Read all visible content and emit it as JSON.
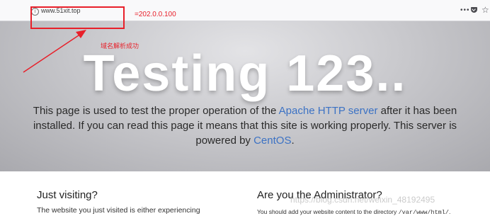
{
  "browser": {
    "url": "www.51xit.top",
    "info_icon": "info-icon",
    "more_icon": "more-icon",
    "pocket_icon": "pocket-icon",
    "star_icon": "bookmark-star-icon"
  },
  "annotation": {
    "ip_text": "=202.0.0.100",
    "caption": "域名解析成功",
    "color": "#e8202a"
  },
  "hero": {
    "title": "Testing 123..",
    "body_1": "This page is used to test the proper operation of the ",
    "link_apache": "Apache HTTP server",
    "body_2": " after it has been installed. If you can read this page it means that this site is working properly. This server is powered by ",
    "link_centos": "CentOS",
    "body_3": "."
  },
  "left_column": {
    "heading": "Just visiting?",
    "text": "The website you just visited is either experiencing"
  },
  "right_column": {
    "heading": "Are you the Administrator?",
    "text_1": "You should add your website content to the directory ",
    "path": "/var/www/html/",
    "text_2": "."
  },
  "watermark": "https://blog.csdn.net/weixin_48192495",
  "colors": {
    "link": "#3c72c4",
    "hero_gray": "#c9c9cd",
    "annotation_red": "#e8202a"
  }
}
